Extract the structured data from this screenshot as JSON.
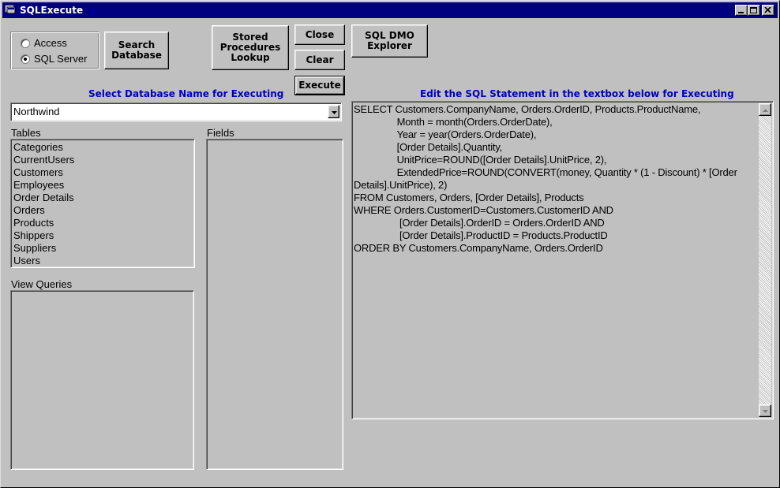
{
  "window": {
    "title": "SQLExecute"
  },
  "source": {
    "options": [
      {
        "label": "Access",
        "checked": false
      },
      {
        "label": "SQL Server",
        "checked": true
      }
    ]
  },
  "buttons": {
    "search_database": "Search\nDatabase",
    "stored_procedures": "Stored\nProcedures\nLookup",
    "close": "Close",
    "clear": "Clear",
    "execute": "Execute",
    "sql_dmo": "SQL DMO\nExplorer"
  },
  "database": {
    "caption": "Select Database Name for Executing",
    "selected": "Northwind"
  },
  "tables": {
    "label": "Tables",
    "items": [
      "Categories",
      "CurrentUsers",
      "Customers",
      "Employees",
      "Order Details",
      "Orders",
      "Products",
      "Shippers",
      "Suppliers",
      "Users"
    ]
  },
  "fields": {
    "label": "Fields",
    "items": []
  },
  "view_queries": {
    "label": "View Queries",
    "items": []
  },
  "sql_editor": {
    "caption": "Edit the SQL Statement in the textbox below for Executing",
    "text": "SELECT Customers.CompanyName, Orders.OrderID, Products.ProductName,\n                Month = month(Orders.OrderDate),\n                Year = year(Orders.OrderDate),\n                [Order Details].Quantity,\n                UnitPrice=ROUND([Order Details].UnitPrice, 2),\n                ExtendedPrice=ROUND(CONVERT(money, Quantity * (1 - Discount) * [Order Details].UnitPrice), 2)\nFROM Customers, Orders, [Order Details], Products\nWHERE Orders.CustomerID=Customers.CustomerID AND\n                 [Order Details].OrderID = Orders.OrderID AND\n                 [Order Details].ProductID = Products.ProductID\nORDER BY Customers.CompanyName, Orders.OrderID"
  },
  "colors": {
    "titlebar": "#000080",
    "caption_text": "#0000c0",
    "face": "#c0c0c0"
  }
}
